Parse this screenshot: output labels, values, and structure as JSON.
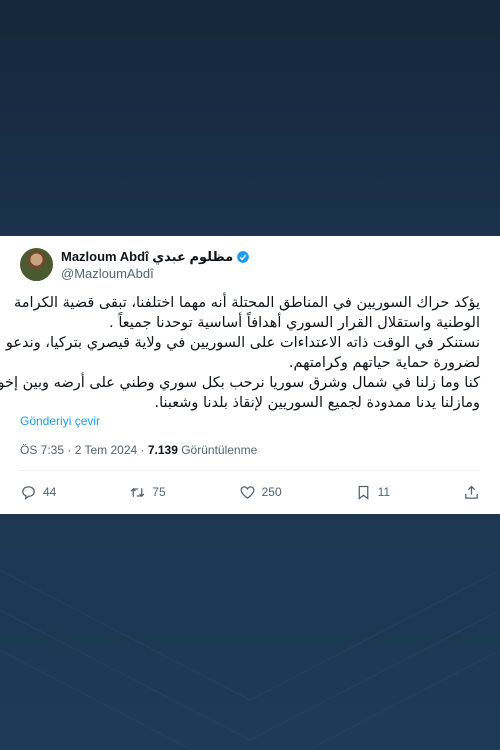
{
  "author": {
    "name": "Mazloum Abdî",
    "name_arabic": "مظلوم عبدي",
    "handle": "@MazloumAbdî"
  },
  "tweet_lines": [
    "يؤكد حراك السوريين في المناطق المحتلة أنه مهما اختلفنا، تبقى قضية الكرامة",
    "الوطنية واستقلال القرار السوري أهدافاً أساسية توحدنا جميعاً .",
    "نستنكر في الوقت  ذاته الاعتداءات على السوريين في ولاية قيصري بتركيا، وندعو",
    "لضرورة حماية حياتهم وكرامتهم.",
    "كنا وما زلنا في شمال وشرق سوريا نرحب بكل سوري وطني على أرضه وبين إخوته",
    "ومازلنا يدنا ممدودة لجميع السوريين لإنقاذ بلدنا وشعبنا."
  ],
  "translate_label": "Gönderiyi çevir",
  "meta": {
    "time_date": "ÖS 7:35 · 2 Tem 2024 · ",
    "views": "7.139",
    "views_label": " Görüntülenme"
  },
  "actions": {
    "replies": "44",
    "reposts": "75",
    "likes": "250",
    "bookmarks": "11"
  },
  "colors": {
    "accent": "#1d9bf0",
    "background": "#15273a"
  }
}
